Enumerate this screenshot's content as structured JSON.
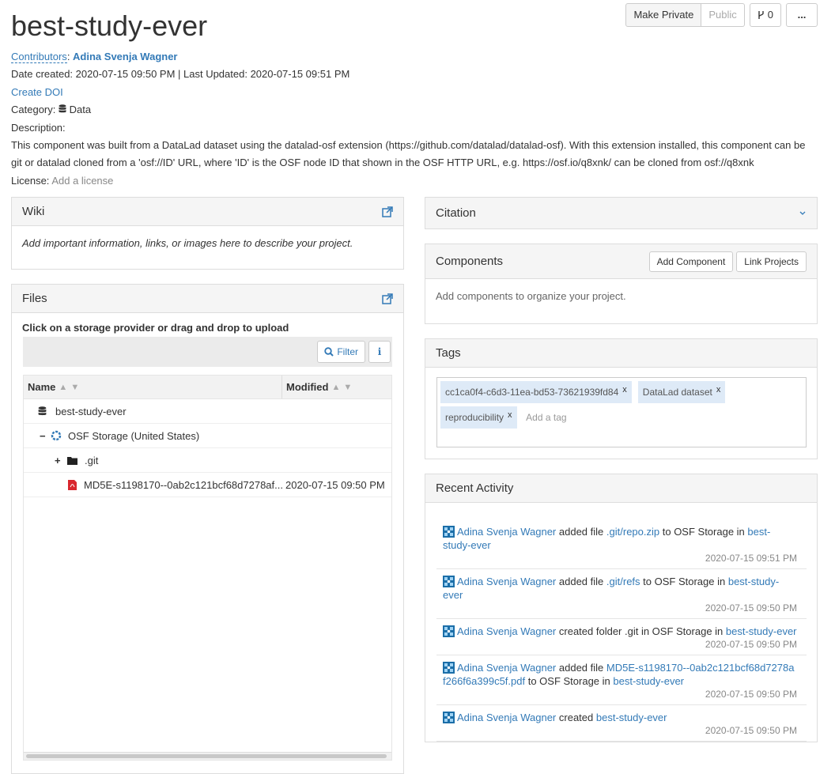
{
  "project": {
    "title": "best-study-ever",
    "contributors_label": "Contributors",
    "contributor_name": "Adina Svenja Wagner",
    "dates_line": "Date created: 2020-07-15 09:50 PM | Last Updated: 2020-07-15 09:51 PM",
    "create_doi": "Create DOI",
    "category_label": "Category:",
    "category_value": "Data",
    "description_label": "Description:",
    "description": "This component was built from a DataLad dataset using the datalad-osf extension (https://github.com/datalad/datalad-osf). With this extension installed, this component can be git or datalad cloned from a 'osf://ID' URL, where 'ID' is the OSF node ID that shown in the OSF HTTP URL, e.g. https://osf.io/q8xnk/ can be cloned from osf://q8xnk",
    "license_label": "License:",
    "license_value": "Add a license"
  },
  "actions": {
    "make_private": "Make Private",
    "public": "Public",
    "fork_count": "0",
    "more": "..."
  },
  "wiki": {
    "title": "Wiki",
    "placeholder": "Add important information, links, or images here to describe your project."
  },
  "files": {
    "title": "Files",
    "hint": "Click on a storage provider or drag and drop to upload",
    "filter": "Filter",
    "info": "i",
    "col_name": "Name",
    "col_modified": "Modified",
    "rows": [
      {
        "name": "best-study-ever",
        "modified": ""
      },
      {
        "name": "OSF Storage (United States)",
        "modified": ""
      },
      {
        "name": ".git",
        "modified": ""
      },
      {
        "name": "MD5E-s1198170--0ab2c121bcf68d7278af...",
        "modified": "2020-07-15 09:50 PM"
      }
    ]
  },
  "citation": {
    "title": "Citation"
  },
  "components": {
    "title": "Components",
    "add": "Add Component",
    "link": "Link Projects",
    "empty": "Add components to organize your project."
  },
  "tags": {
    "title": "Tags",
    "items": [
      "cc1ca0f4-c6d3-11ea-bd53-73621939fd84",
      "DataLad dataset",
      "reproducibility"
    ],
    "remove": "x",
    "add_placeholder": "Add a tag"
  },
  "activity": {
    "title": "Recent Activity",
    "items": [
      {
        "user": "Adina Svenja Wagner",
        "verb": "added file",
        "target": ".git/repo.zip",
        "mid": "to OSF Storage in",
        "project": "best-study-ever",
        "time": "2020-07-15 09:51 PM"
      },
      {
        "user": "Adina Svenja Wagner",
        "verb": "added file",
        "target": ".git/refs",
        "mid": "to OSF Storage in",
        "project": "best-study-ever",
        "time": "2020-07-15 09:50 PM"
      },
      {
        "user": "Adina Svenja Wagner",
        "verb": "created folder .git in OSF Storage in",
        "target": "",
        "mid": "",
        "project": "best-study-ever",
        "time": "2020-07-15 09:50 PM"
      },
      {
        "user": "Adina Svenja Wagner",
        "verb": "added file",
        "target": "MD5E-s1198170--0ab2c121bcf68d7278af266f6a399c5f.pdf",
        "mid": "to OSF Storage in",
        "project": "best-study-ever",
        "time": "2020-07-15 09:50 PM"
      },
      {
        "user": "Adina Svenja Wagner",
        "verb": "created",
        "target": "",
        "mid": "",
        "project": "best-study-ever",
        "time": "2020-07-15 09:50 PM"
      }
    ]
  }
}
